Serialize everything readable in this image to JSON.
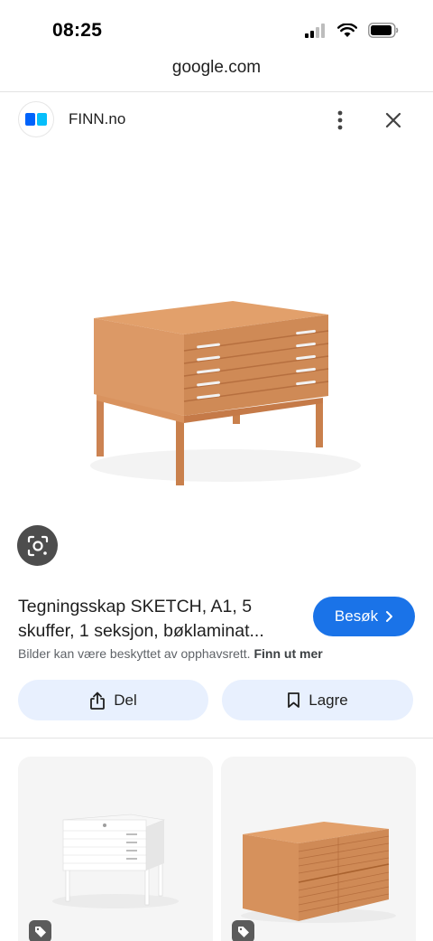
{
  "status_bar": {
    "time": "08:25",
    "icons": [
      "signal-icon",
      "wifi-icon",
      "battery-icon"
    ]
  },
  "browser": {
    "url": "google.com"
  },
  "source": {
    "name": "FINN.no",
    "favicon": "finn-logo-icon",
    "brand_color": "#0063fb"
  },
  "result": {
    "title": "Tegningsskap SKETCH, A1, 5 skuffer, 1 seksjon, bøklaminat...",
    "visit_label": "Besøk",
    "copyright_text": "Bilder kan være beskyttet av opphavsrett.",
    "copyright_link": "Finn ut mer",
    "accent_color": "#1a73e8"
  },
  "actions": {
    "share_label": "Del",
    "save_label": "Lagre"
  },
  "related": [
    {
      "product": "white plan chest on legs",
      "tag_icon": "price-tag-icon"
    },
    {
      "product": "beech plan chest with two sections",
      "tag_icon": "price-tag-icon"
    }
  ]
}
